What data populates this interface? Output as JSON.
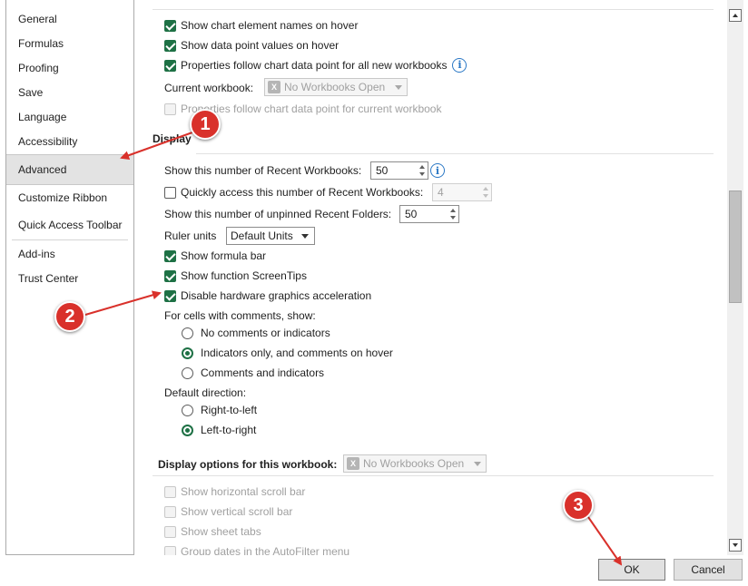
{
  "nav": {
    "items": [
      "General",
      "Formulas",
      "Proofing",
      "Save",
      "Language",
      "Accessibility",
      "Advanced",
      "Customize Ribbon",
      "Quick Access Toolbar",
      "Add-ins",
      "Trust Center"
    ],
    "active": "Advanced"
  },
  "chart": {
    "show_names": "Show chart element names on hover",
    "show_values": "Show data point values on hover",
    "properties_follow_all": "Properties follow chart data point for all new workbooks",
    "current_workbook_label": "Current workbook:",
    "current_workbook_value": "No Workbooks Open",
    "properties_follow_current": "Properties follow chart data point for current workbook"
  },
  "display": {
    "title": "Display",
    "recent_workbooks_label": "Show this number of Recent Workbooks:",
    "recent_workbooks_value": "50",
    "quick_access_label": "Quickly access this number of Recent Workbooks:",
    "quick_access_value": "4",
    "recent_folders_label": "Show this number of unpinned Recent Folders:",
    "recent_folders_value": "50",
    "ruler_units_label": "Ruler units",
    "ruler_units_value": "Default Units",
    "show_formula_bar": "Show formula bar",
    "show_screentips": "Show function ScreenTips",
    "disable_hw_accel": "Disable hardware graphics acceleration",
    "comments_label": "For cells with comments, show:",
    "comments_none": "No comments or indicators",
    "comments_indicators": "Indicators only, and comments on hover",
    "comments_both": "Comments and indicators",
    "direction_label": "Default direction:",
    "direction_rtl": "Right-to-left",
    "direction_ltr": "Left-to-right"
  },
  "workbook_display": {
    "title": "Display options for this workbook:",
    "combo_value": "No Workbooks Open",
    "h_scroll": "Show horizontal scroll bar",
    "v_scroll": "Show vertical scroll bar",
    "sheet_tabs": "Show sheet tabs",
    "group_dates": "Group dates in the AutoFilter menu"
  },
  "buttons": {
    "ok": "OK",
    "cancel": "Cancel"
  },
  "markers": [
    "1",
    "2",
    "3"
  ],
  "colors": {
    "accent": "#1e7145",
    "marker": "#d9312b",
    "info": "#2b78c5"
  }
}
